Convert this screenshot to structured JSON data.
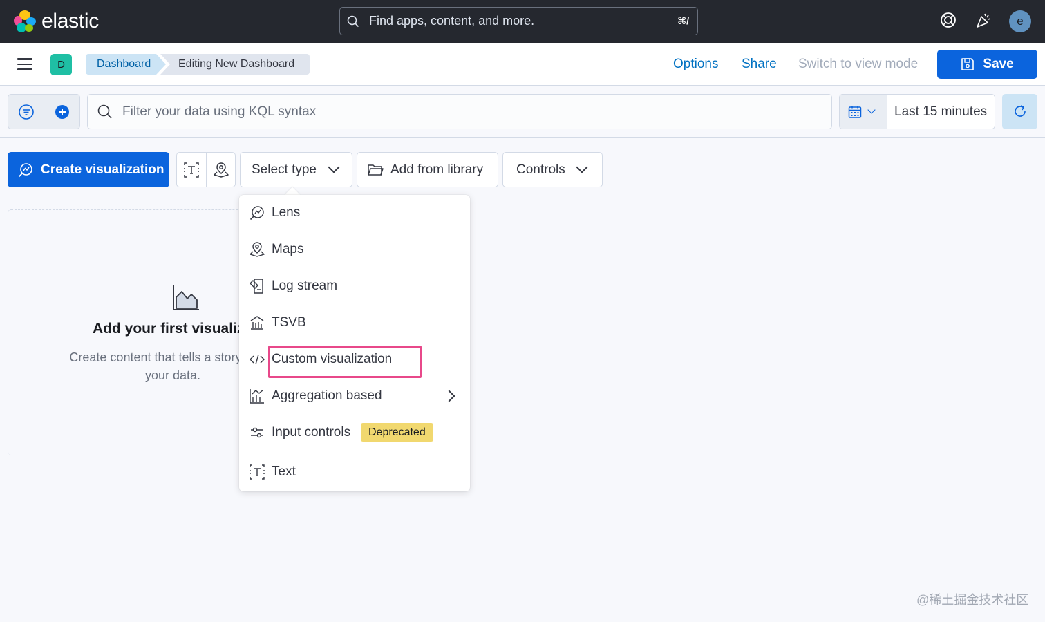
{
  "brand": {
    "name": "elastic"
  },
  "global_search": {
    "placeholder": "Find apps, content, and more.",
    "shortcut": "⌘/"
  },
  "user": {
    "avatar_letter": "e"
  },
  "space": {
    "letter": "D"
  },
  "breadcrumbs": [
    "Dashboard",
    "Editing New Dashboard"
  ],
  "nav_actions": {
    "options": "Options",
    "share": "Share",
    "switch_mode": "Switch to view mode",
    "save": "Save"
  },
  "query": {
    "placeholder": "Filter your data using KQL syntax"
  },
  "date_picker": {
    "label": "Last 15 minutes"
  },
  "toolbar": {
    "create_visualization": "Create visualization",
    "select_type": "Select type",
    "add_from_library": "Add from library",
    "controls": "Controls"
  },
  "empty_state": {
    "title": "Add your first visualization",
    "description": "Create content that tells a story about your data."
  },
  "type_menu": {
    "items": [
      {
        "label": "Lens",
        "icon": "lens-icon"
      },
      {
        "label": "Maps",
        "icon": "maps-icon"
      },
      {
        "label": "Log stream",
        "icon": "log-stream-icon"
      },
      {
        "label": "TSVB",
        "icon": "tsvb-icon"
      },
      {
        "label": "Custom visualization",
        "icon": "code-icon",
        "highlighted": true
      },
      {
        "label": "Aggregation based",
        "icon": "aggregation-icon",
        "has_submenu": true
      },
      {
        "label": "Input controls",
        "icon": "input-controls-icon",
        "badge": "Deprecated"
      },
      {
        "label": "Text",
        "icon": "text-icon"
      }
    ]
  },
  "watermark": "@稀土掘金技术社区",
  "colors": {
    "header_bg": "#25282f",
    "primary": "#0b64dd",
    "link": "#0071c2",
    "highlight": "#e8488a",
    "badge_deprecated": "#f1d86f"
  }
}
